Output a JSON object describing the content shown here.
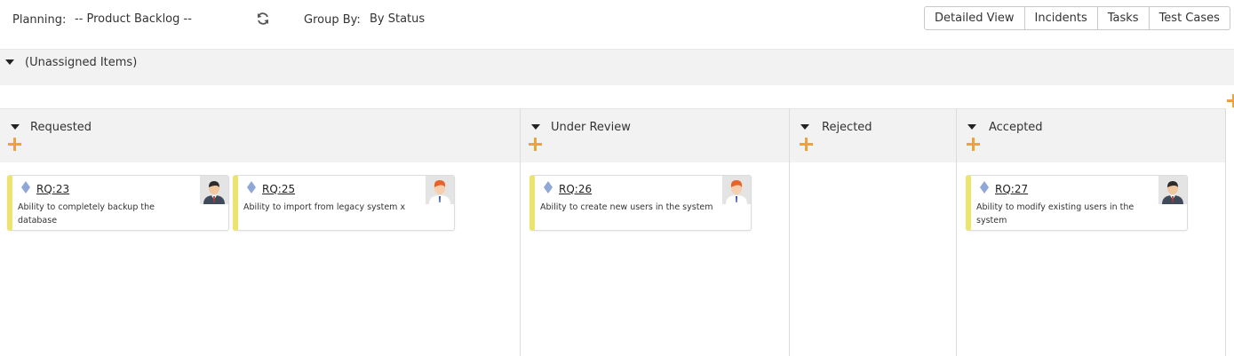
{
  "toolbar": {
    "planning_label": "Planning:",
    "planning_value": "-- Product Backlog --",
    "group_by_label": "Group By:",
    "group_by_value": "By Status",
    "view_buttons": [
      "Detailed View",
      "Incidents",
      "Tasks",
      "Test Cases"
    ]
  },
  "unassigned": {
    "label": "(Unassigned Items)"
  },
  "columns": [
    {
      "title": "Requested",
      "cards": [
        {
          "id": "RQ:23",
          "description": "Ability to completely backup the database",
          "avatar": "man-dark-hair"
        },
        {
          "id": "RQ:25",
          "description": "Ability to import from legacy system x",
          "avatar": "man-red-hair"
        }
      ]
    },
    {
      "title": "Under Review",
      "cards": [
        {
          "id": "RQ:26",
          "description": "Ability to create new users in the system",
          "avatar": "man-red-hair"
        }
      ]
    },
    {
      "title": "Rejected",
      "cards": []
    },
    {
      "title": "Accepted",
      "cards": [
        {
          "id": "RQ:27",
          "description": "Ability to modify existing users in the system",
          "avatar": "man-dark-hair"
        }
      ]
    }
  ],
  "colors": {
    "accent_plus": "#f0a13a",
    "card_stripe": "#ece56d",
    "diamond": "#8fa8d8",
    "header_bg": "#f2f2f2"
  }
}
